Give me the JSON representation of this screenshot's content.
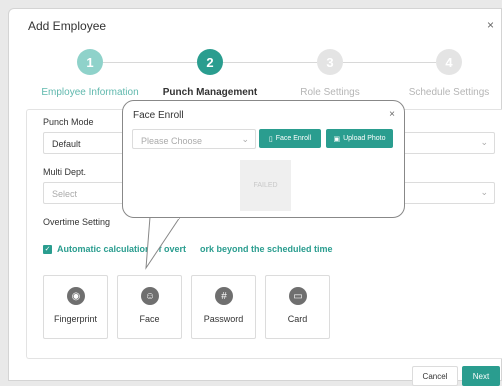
{
  "dialog": {
    "title": "Add Employee",
    "close": "×"
  },
  "steps": [
    {
      "number": "1",
      "label": "Employee Information"
    },
    {
      "number": "2",
      "label": "Punch Management"
    },
    {
      "number": "3",
      "label": "Role Settings"
    },
    {
      "number": "4",
      "label": "Schedule Settings"
    }
  ],
  "form": {
    "punch_mode_label": "Punch Mode",
    "punch_mode_value": "Default",
    "multi_dept_label": "Multi Dept.",
    "multi_dept_value": "Select",
    "overtime_label": "Overtime Setting",
    "auto_calc_text": "Automatic calculation of overt",
    "auto_calc_tail": "ork beyond the scheduled time",
    "methods": [
      "Fingerprint",
      "Face",
      "Password",
      "Card"
    ]
  },
  "popup": {
    "title": "Face Enroll",
    "close": "×",
    "select_placeholder": "Please Choose",
    "face_enroll_btn": "Face Enroll",
    "upload_photo_btn": "Upload Photo",
    "status": "FAILED"
  },
  "footer": {
    "cancel": "Cancel",
    "next": "Next"
  },
  "colors": {
    "accent": "#2a9d8f",
    "step_active_done": "#6ec4ba",
    "step_inactive": "#dcdcdc"
  }
}
